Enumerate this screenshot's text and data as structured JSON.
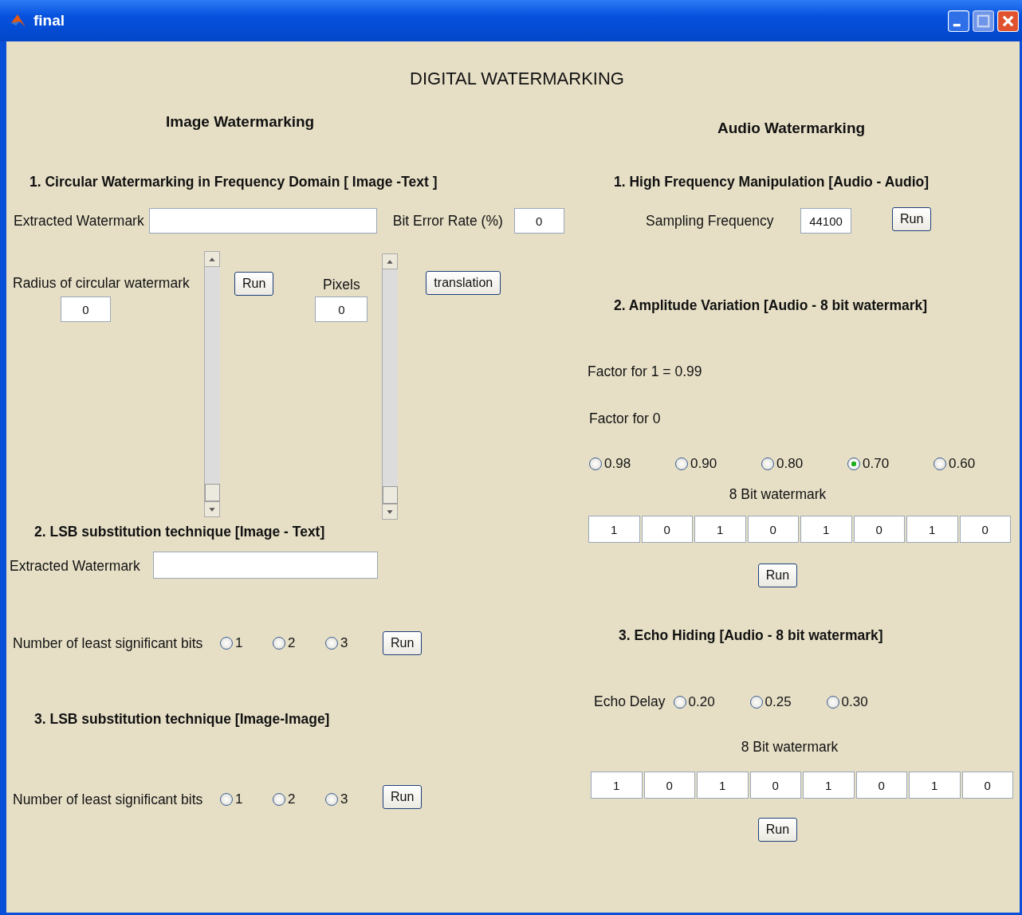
{
  "window": {
    "title": "final"
  },
  "heading": "DIGITAL WATERMARKING",
  "image": {
    "title": "Image Watermarking",
    "circular": {
      "title": "1.  Circular Watermarking in Frequency Domain [ Image -Text ]",
      "extracted_label": "Extracted Watermark",
      "ber_label": "Bit Error Rate (%)",
      "ber_value": "0",
      "radius_label": "Radius of  circular watermark",
      "radius_value": "0",
      "radius_slider": {
        "level": 0
      },
      "run": "Run",
      "pixels_label": "Pixels",
      "pixels_value": "0",
      "pixels_slider": {
        "level": 0
      },
      "translation": "translation"
    },
    "lsb_text": {
      "title": "2.  LSB substitution technique [Image - Text]",
      "extracted_label": "Extracted Watermark",
      "bits_label": "Number of least significant bits",
      "options": [
        {
          "label": "1",
          "selected": false
        },
        {
          "label": "2",
          "selected": false
        },
        {
          "label": "3",
          "selected": false
        }
      ],
      "run": "Run"
    },
    "lsb_image": {
      "title": "3.  LSB substitution technique [Image-Image]",
      "bits_label": "Number of least significant bits",
      "options": [
        {
          "label": "1",
          "selected": false
        },
        {
          "label": "2",
          "selected": false
        },
        {
          "label": "3",
          "selected": false
        }
      ],
      "run": "Run"
    }
  },
  "audio": {
    "title": "Audio Watermarking",
    "hfm": {
      "title": "1.  High Frequency Manipulation [Audio - Audio]",
      "sampling_label": "Sampling Frequency",
      "sampling_value": "44100",
      "run": "Run"
    },
    "amplitude": {
      "title": "2.  Amplitude Variation [Audio - 8 bit watermark]",
      "factor1": "Factor for 1 = 0.99",
      "factor0_label": "Factor for 0",
      "options": [
        {
          "label": "0.98",
          "selected": false
        },
        {
          "label": "0.90",
          "selected": false
        },
        {
          "label": "0.80",
          "selected": false
        },
        {
          "label": "0.70",
          "selected": true
        },
        {
          "label": "0.60",
          "selected": false
        }
      ],
      "bits_label": "8 Bit watermark",
      "bits": [
        "1",
        "0",
        "1",
        "0",
        "1",
        "0",
        "1",
        "0"
      ],
      "run": "Run"
    },
    "echo": {
      "title": "3.  Echo Hiding [Audio - 8 bit watermark]",
      "delay_label": "Echo Delay",
      "options": [
        {
          "label": "0.20",
          "selected": false
        },
        {
          "label": "0.25",
          "selected": false
        },
        {
          "label": "0.30",
          "selected": false
        }
      ],
      "bits_label": "8 Bit watermark",
      "bits": [
        "1",
        "0",
        "1",
        "0",
        "1",
        "0",
        "1",
        "0"
      ],
      "run": "Run"
    }
  }
}
